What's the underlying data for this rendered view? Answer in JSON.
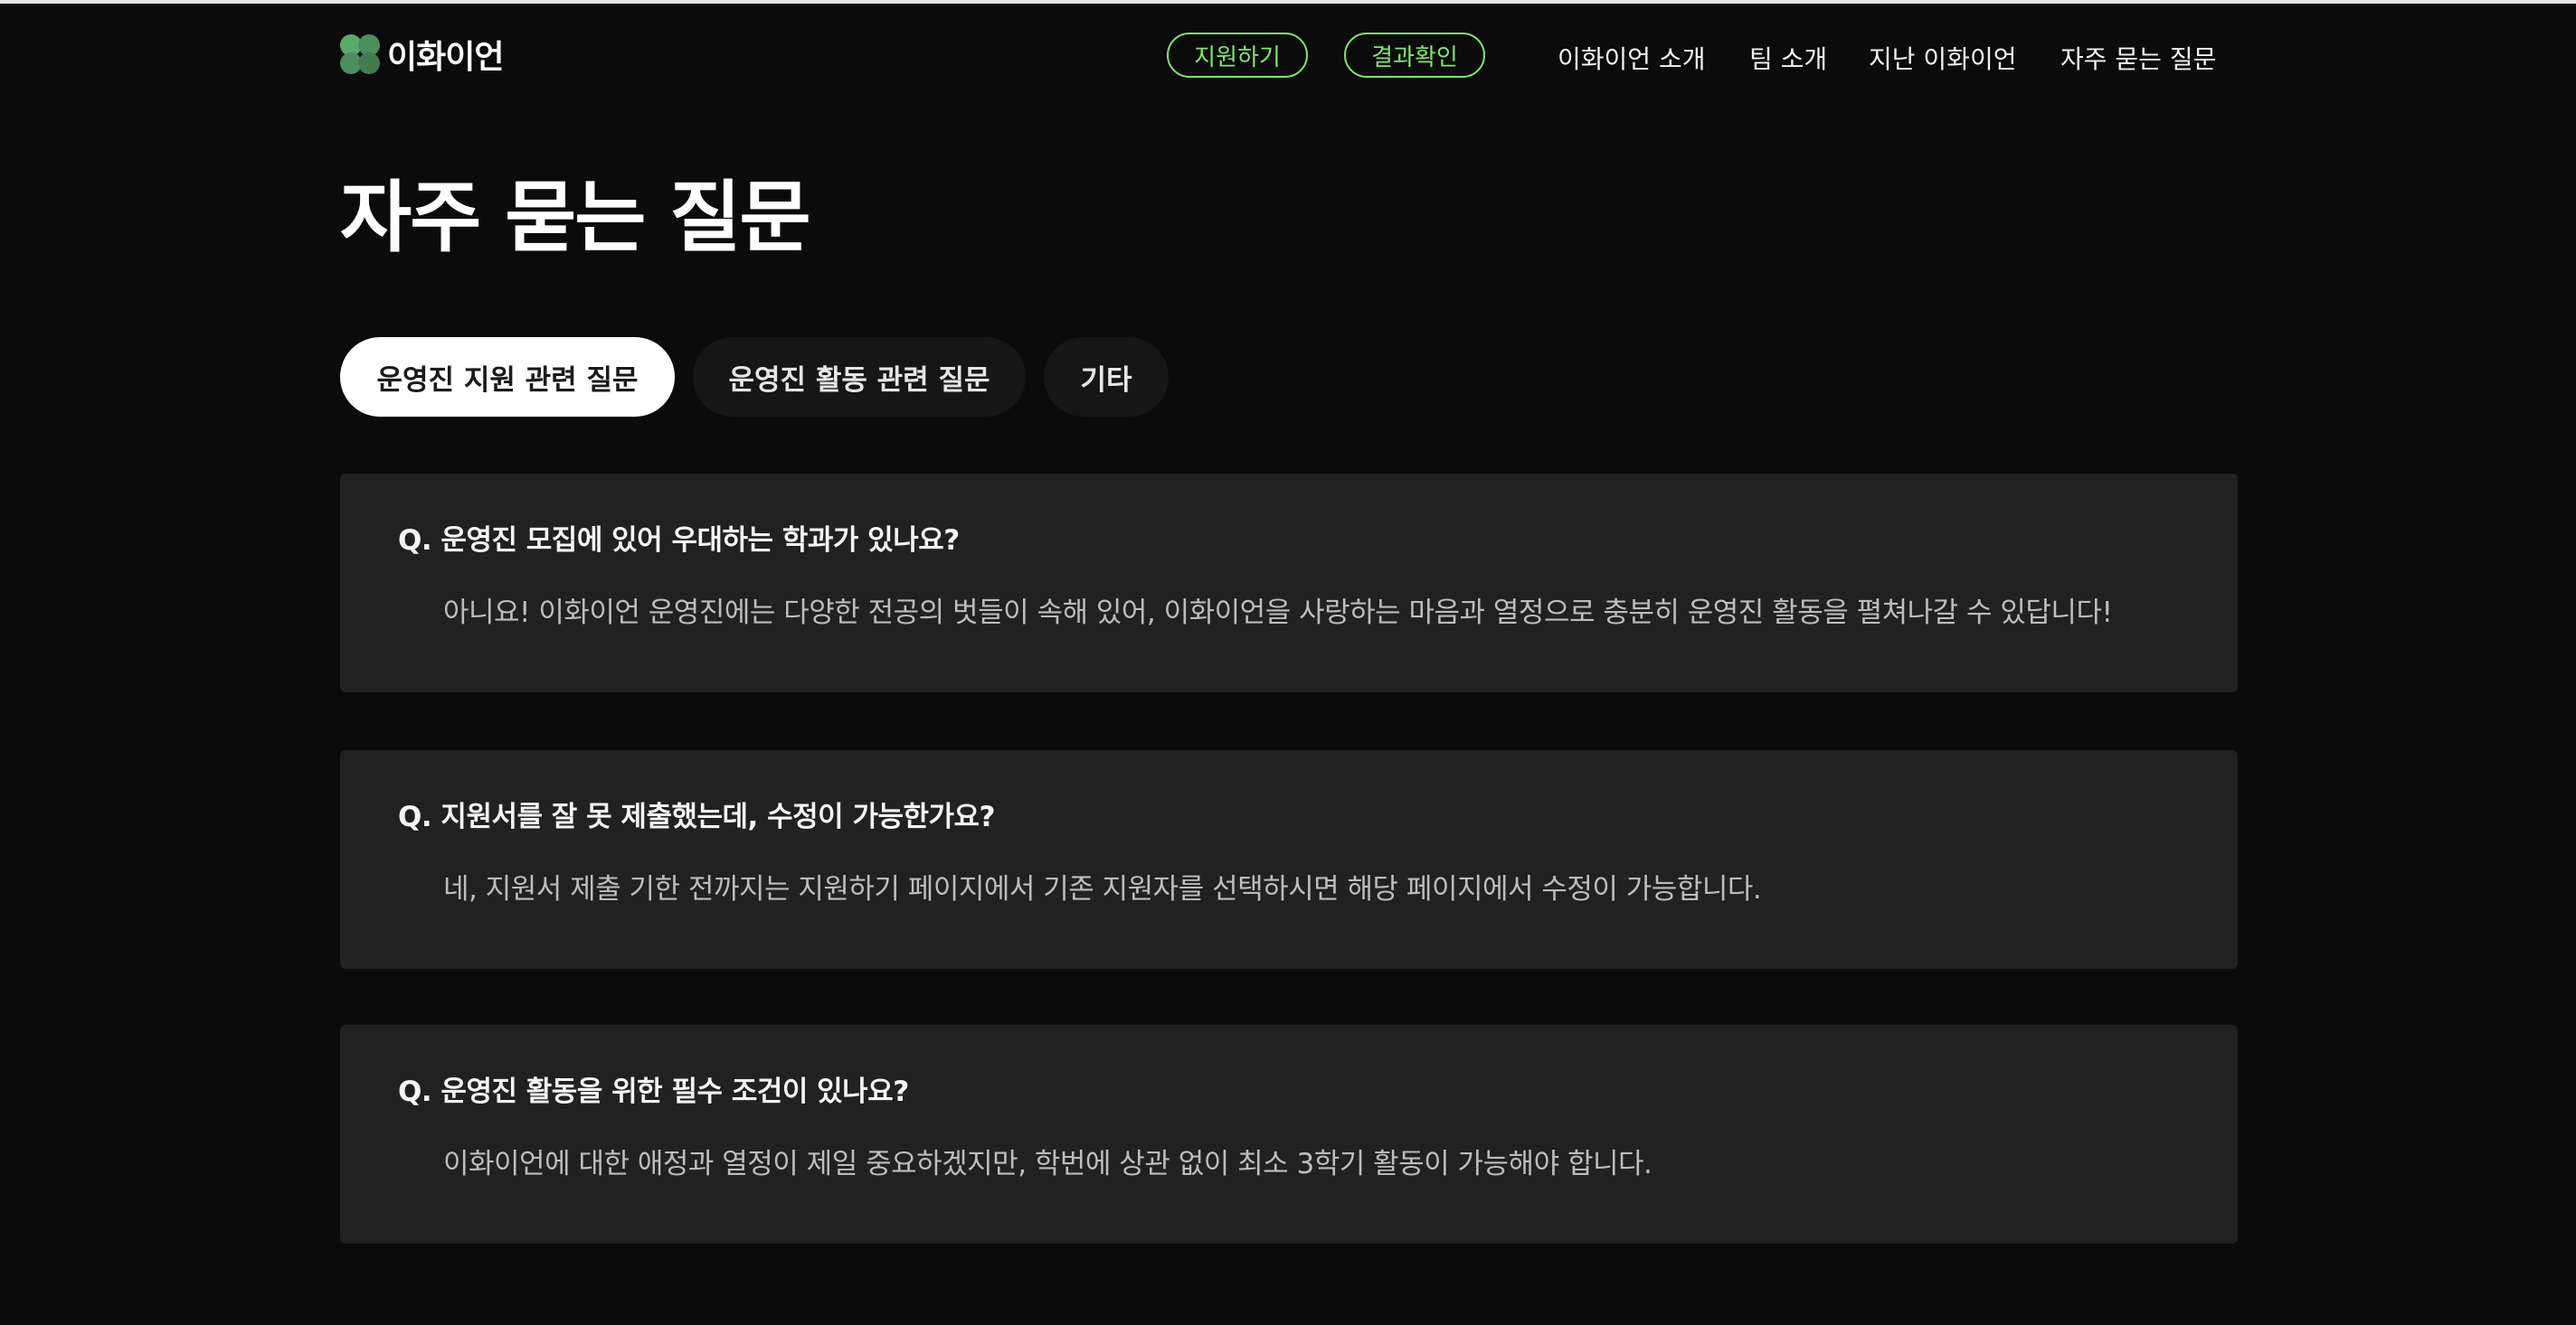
{
  "brand": {
    "logo_text": "이화이언",
    "logo_icon": "clover-logo-icon",
    "accent_color": "#7ee76a"
  },
  "header": {
    "apply_button": "지원하기",
    "result_button": "결과확인",
    "nav": [
      "이화이언 소개",
      "팀 소개",
      "지난 이화이언",
      "자주 묻는 질문"
    ]
  },
  "page": {
    "title": "자주 묻는 질문"
  },
  "tabs": [
    {
      "label": "운영진 지원 관련 질문",
      "active": true
    },
    {
      "label": "운영진 활동 관련 질문",
      "active": false
    },
    {
      "label": "기타",
      "active": false
    }
  ],
  "faq": [
    {
      "question": "Q. 운영진 모집에 있어 우대하는 학과가 있나요?",
      "answer": "아니요! 이화이언 운영진에는 다양한 전공의 벗들이 속해 있어, 이화이언을 사랑하는 마음과 열정으로 충분히 운영진 활동을 펼쳐나갈 수 있답니다!"
    },
    {
      "question": "Q. 지원서를 잘 못 제출했는데, 수정이 가능한가요?",
      "answer": "네, 지원서 제출 기한 전까지는 지원하기 페이지에서 기존 지원자를 선택하시면 해당 페이지에서 수정이 가능합니다."
    },
    {
      "question": "Q. 운영진 활동을 위한 필수 조건이 있나요?",
      "answer": "이화이언에 대한 애정과 열정이 제일 중요하겠지만, 학번에 상관 없이 최소 3학기 활동이 가능해야 합니다."
    }
  ]
}
